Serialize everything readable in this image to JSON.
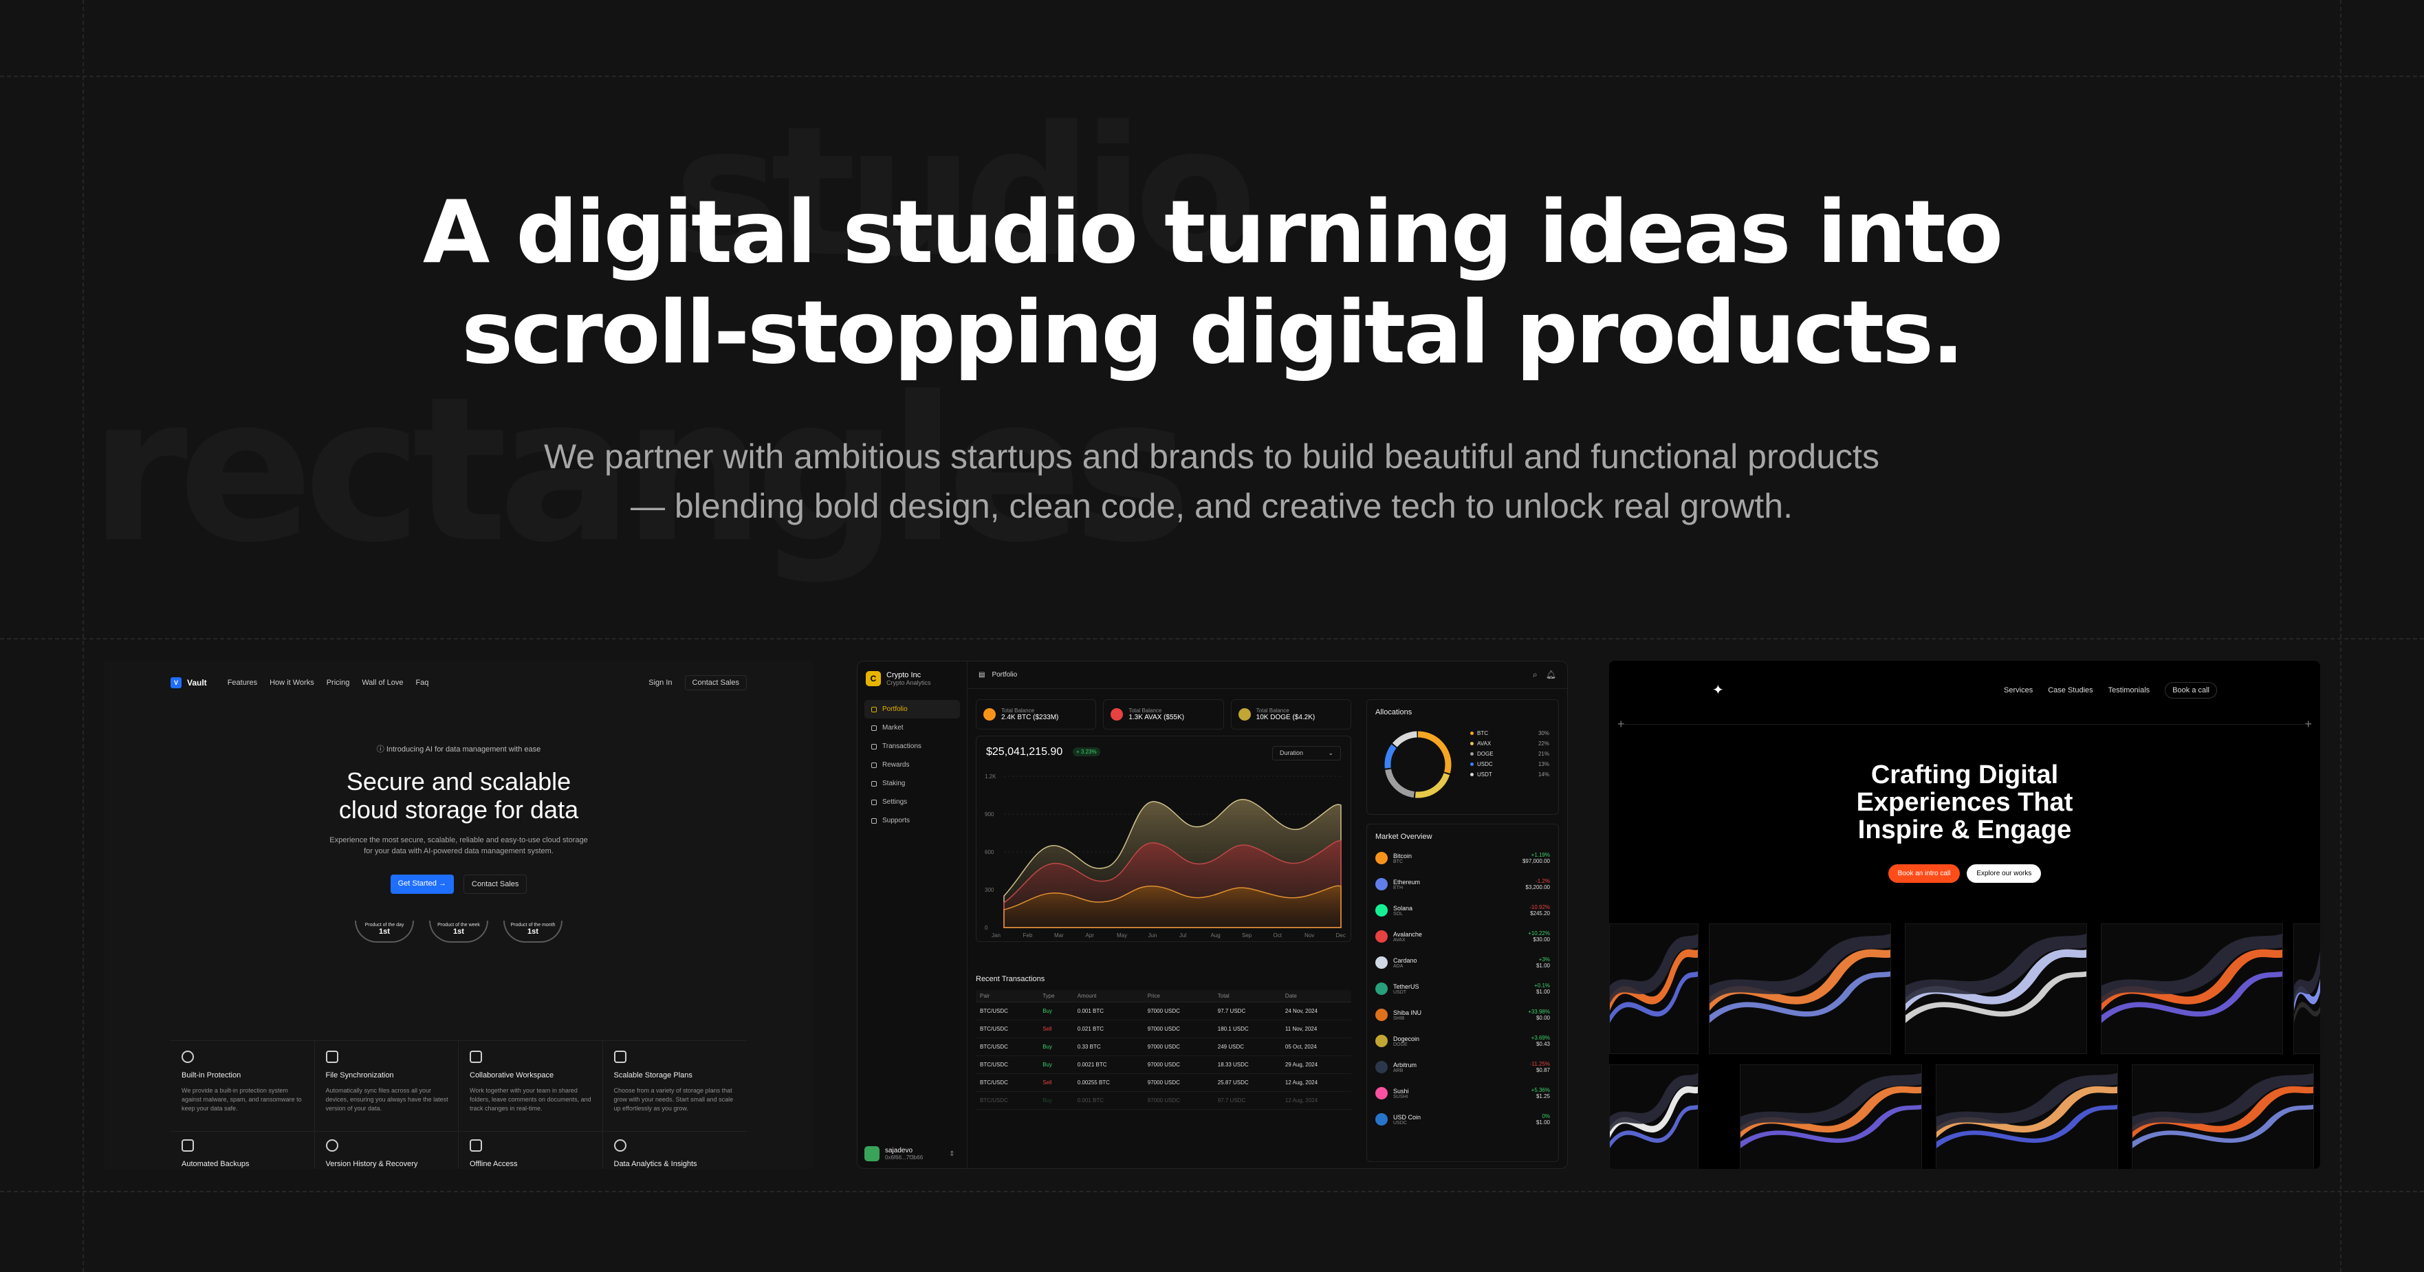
{
  "background_words": [
    "studio",
    "rectangles"
  ],
  "hero": {
    "title": "A digital studio turning ideas into scroll-stopping digital products.",
    "subtitle": "We partner with ambitious startups and brands to build beautiful and functional products — blending bold design, clean code, and creative tech to unlock real growth."
  },
  "vault": {
    "logo_mark": "V",
    "logo_text": "Vault",
    "nav": [
      "Features",
      "How it Works",
      "Pricing",
      "Wall of Love",
      "Faq"
    ],
    "sign_in": "Sign In",
    "contact_sales": "Contact Sales",
    "pill": "Introducing AI for data management with ease",
    "headline": "Secure and scalable cloud storage for data",
    "description": "Experience the most secure, scalable, reliable and easy-to-use cloud storage for your data with AI-powered data management system.",
    "cta_primary": "Get Started →",
    "cta_secondary": "Contact Sales",
    "awards": [
      {
        "label": "Product of the day",
        "rank": "1st"
      },
      {
        "label": "Product of the week",
        "rank": "1st"
      },
      {
        "label": "Product of the month",
        "rank": "1st"
      }
    ],
    "features": [
      {
        "title": "Built-in Protection",
        "desc": "We provide a built-in protection system against malware, spam, and ransomware to keep your data safe."
      },
      {
        "title": "File Synchronization",
        "desc": "Automatically sync files across all your devices, ensuring you always have the latest version of your data."
      },
      {
        "title": "Collaborative Workspace",
        "desc": "Work together with your team in shared folders, leave comments on documents, and track changes in real-time."
      },
      {
        "title": "Scalable Storage Plans",
        "desc": "Choose from a variety of storage plans that grow with your needs. Start small and scale up effortlessly as you grow."
      }
    ],
    "features_row2": [
      "Automated Backups",
      "Version History & Recovery",
      "Offline Access",
      "Data Analytics & Insights"
    ]
  },
  "crypto": {
    "brand": "Crypto Inc",
    "brand_sub": "Crypto Analytics",
    "menu": [
      "Portfolio",
      "Market",
      "Transactions",
      "Rewards",
      "Staking",
      "Settings",
      "Supports"
    ],
    "active_menu": "Portfolio",
    "topbar_title": "Portfolio",
    "user_name": "sajadevo",
    "user_sub": "0x6f66...7f3b66",
    "balances": [
      {
        "label": "Total Balance",
        "value": "2.4K BTC ($233M)",
        "color": "#f7931a"
      },
      {
        "label": "Total Balance",
        "value": "1.3K AVAX ($55K)",
        "color": "#e84142"
      },
      {
        "label": "Total Balance",
        "value": "10K DOGE ($4.2K)",
        "color": "#c2a633"
      }
    ],
    "total_value": "$25,041,215.90",
    "change": "+ 3.23%",
    "duration": "Duration",
    "chart_y_ticks": [
      "1.2K",
      "900",
      "600",
      "300",
      "0"
    ],
    "chart_x_ticks": [
      "Jan",
      "Feb",
      "Mar",
      "Apr",
      "May",
      "Jun",
      "Jul",
      "Aug",
      "Sep",
      "Oct",
      "Nov",
      "Dec"
    ],
    "transactions_title": "Recent Transactions",
    "tx_headers": [
      "Pair",
      "Type",
      "Amount",
      "Price",
      "Total",
      "Date"
    ],
    "transactions": [
      [
        "BTC/USDC",
        "Buy",
        "0.001 BTC",
        "97000 USDC",
        "97.7 USDC",
        "24 Nov, 2024"
      ],
      [
        "BTC/USDC",
        "Sell",
        "0.021 BTC",
        "97000 USDC",
        "180.1 USDC",
        "11 Nov, 2024"
      ],
      [
        "BTC/USDC",
        "Buy",
        "0.33 BTC",
        "97000 USDC",
        "249 USDC",
        "05 Oct, 2024"
      ],
      [
        "BTC/USDC",
        "Buy",
        "0.0021 BTC",
        "97000 USDC",
        "18.33 USDC",
        "29 Aug, 2024"
      ],
      [
        "BTC/USDC",
        "Sell",
        "0.00255 BTC",
        "97000 USDC",
        "25.87 USDC",
        "12 Aug, 2024"
      ],
      [
        "BTC/USDC",
        "Buy",
        "0.001 BTC",
        "97000 USDC",
        "97.7 USDC",
        "12 Aug, 2024"
      ]
    ],
    "allocations_title": "Allocations",
    "allocations": [
      {
        "name": "BTC",
        "pct": "30%",
        "color": "#f5a623"
      },
      {
        "name": "AVAX",
        "pct": "22%",
        "color": "#e6c84a"
      },
      {
        "name": "DOGE",
        "pct": "21%",
        "color": "#9e9e9e"
      },
      {
        "name": "USDC",
        "pct": "13%",
        "color": "#3b82f6"
      },
      {
        "name": "USDT",
        "pct": "14%",
        "color": "#d9d9d9"
      }
    ],
    "market_title": "Market Overview",
    "market": [
      {
        "name": "Bitcoin",
        "sym": "BTC",
        "chg": "+1.19%",
        "price": "$97,000.00",
        "up": true,
        "color": "#f7931a"
      },
      {
        "name": "Ethereum",
        "sym": "ETH",
        "chg": "-1.2%",
        "price": "$3,200.00",
        "up": false,
        "color": "#627eea"
      },
      {
        "name": "Solana",
        "sym": "SOL",
        "chg": "-10.92%",
        "price": "$245.20",
        "up": false,
        "color": "#14f195"
      },
      {
        "name": "Avalanche",
        "sym": "AVAX",
        "chg": "+10.22%",
        "price": "$30.00",
        "up": true,
        "color": "#e84142"
      },
      {
        "name": "Cardano",
        "sym": "ADA",
        "chg": "+3%",
        "price": "$1.00",
        "up": true,
        "color": "#cfd8e3"
      },
      {
        "name": "TetherUS",
        "sym": "USDT",
        "chg": "+0.1%",
        "price": "$1.00",
        "up": true,
        "color": "#26a17b"
      },
      {
        "name": "Shiba INU",
        "sym": "SHIB",
        "chg": "+33.98%",
        "price": "$0.00",
        "up": true,
        "color": "#e0711c"
      },
      {
        "name": "Dogecoin",
        "sym": "DOGE",
        "chg": "+3.69%",
        "price": "$0.43",
        "up": true,
        "color": "#c2a633"
      },
      {
        "name": "Arbitrum",
        "sym": "ARB",
        "chg": "-11.25%",
        "price": "$0.87",
        "up": false,
        "color": "#2d374b"
      },
      {
        "name": "Sushi",
        "sym": "SUSHI",
        "chg": "+5.36%",
        "price": "$1.25",
        "up": true,
        "color": "#fa52a0"
      },
      {
        "name": "USD Coin",
        "sym": "USDC",
        "chg": "0%",
        "price": "$1.00",
        "up": true,
        "color": "#2775ca"
      }
    ]
  },
  "studio": {
    "nav": [
      "Services",
      "Case Studies",
      "Testimonials"
    ],
    "book_call": "Book a call",
    "headline": "Crafting Digital Experiences That Inspire & Engage",
    "cta_primary": "Book an intro call",
    "cta_secondary": "Explore our works"
  }
}
